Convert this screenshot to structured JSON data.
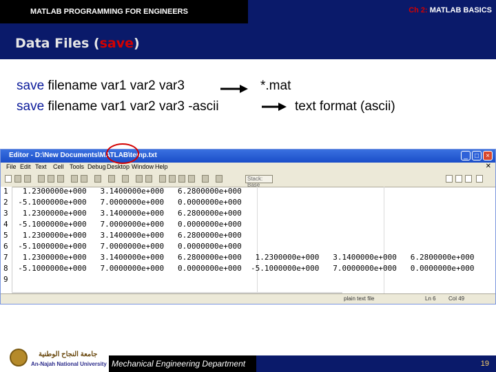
{
  "header": {
    "course": "MATLAB PROGRAMMING FOR ENGINEERS",
    "chapter_num": "Ch 2:",
    "chapter_title": "MATLAB BASICS"
  },
  "slide": {
    "title_prefix": "Data Files (",
    "title_highlight": "save",
    "title_suffix": ")"
  },
  "commands": [
    {
      "keyword": "save",
      "args": " filename var1 var2 var3",
      "result": "*.mat"
    },
    {
      "keyword": "save",
      "args": " filename var1 var2 var3  -ascii",
      "result": "text format (ascii)"
    }
  ],
  "editor": {
    "title": "Editor - D:\\New Documents\\MATLAB\\temp.txt",
    "menu": [
      "File",
      "Edit",
      "Text",
      "Cell",
      "Tools",
      "Debug",
      "Desktop",
      "Window",
      "Help"
    ],
    "stack_label": "Stack: Base",
    "line_numbers": [
      "1",
      "2",
      "3",
      "4",
      "5",
      "6",
      "7",
      "8",
      "9"
    ],
    "lines": [
      "   1.2300000e+000   3.1400000e+000   6.2800000e+000",
      "  -5.1000000e+000   7.0000000e+000   0.0000000e+000",
      "   1.2300000e+000   3.1400000e+000   6.2800000e+000",
      "  -5.1000000e+000   7.0000000e+000   0.0000000e+000",
      "   1.2300000e+000   3.1400000e+000   6.2800000e+000",
      "  -5.1000000e+000   7.0000000e+000   0.0000000e+000",
      "   1.2300000e+000   3.1400000e+000   6.2800000e+000   1.2300000e+000   3.1400000e+000   6.2800000e+000",
      "  -5.1000000e+000   7.0000000e+000   0.0000000e+000  -5.1000000e+000   7.0000000e+000   0.0000000e+000",
      ""
    ],
    "status_file": "plain text file",
    "status_ln": "Ln  6",
    "status_col": "Col  49"
  },
  "footer": {
    "university_ar": "جامعة النجاح الوطنية",
    "university_en": "An-Najah National University",
    "department": "Mechanical Engineering Department",
    "page": "19"
  }
}
